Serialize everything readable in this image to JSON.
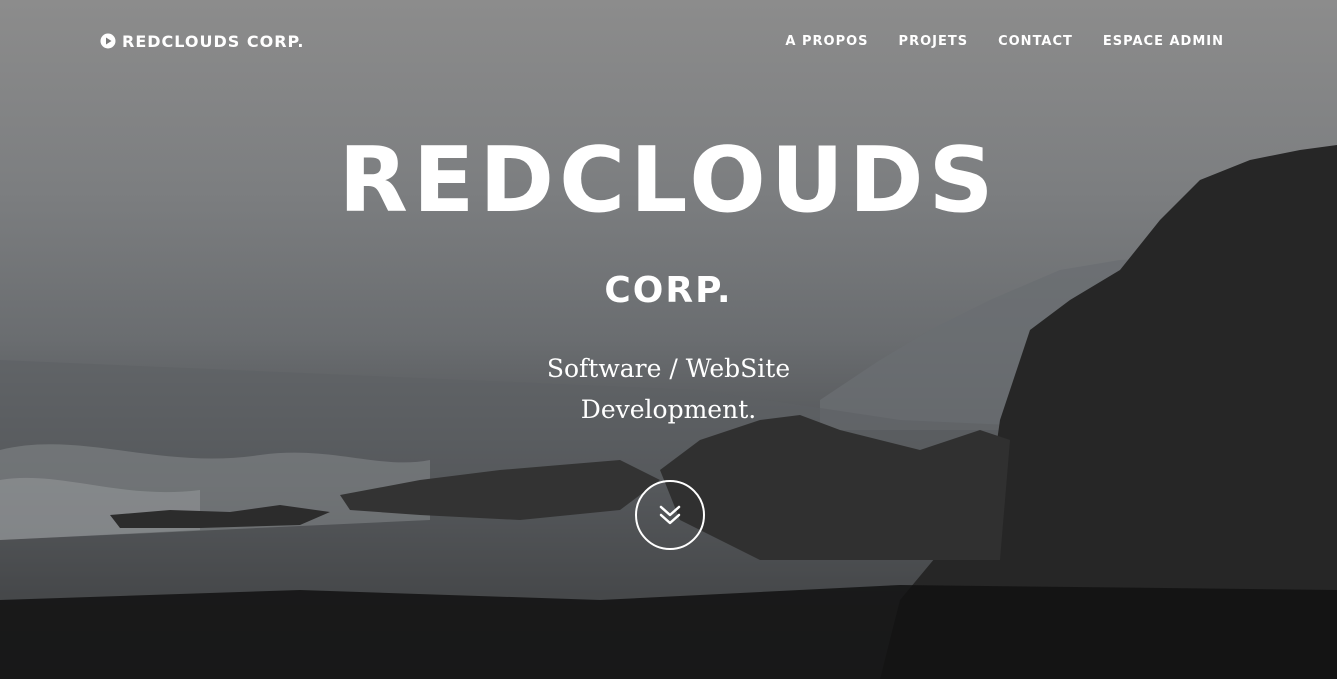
{
  "navbar": {
    "brand_label": "REDCLOUDS CORP.",
    "brand_icon": "play-circle-icon",
    "links": [
      {
        "label": "A PROPOS"
      },
      {
        "label": "PROJETS"
      },
      {
        "label": "CONTACT"
      },
      {
        "label": "ESPACE ADMIN"
      }
    ]
  },
  "hero": {
    "title": "REDCLOUDS",
    "subtitle": "CORP.",
    "tagline_line1": "Software / WebSite",
    "tagline_line2": "Development.",
    "scroll_icon": "double-chevron-down-icon"
  },
  "colors": {
    "text": "#ffffff",
    "background_top": "#8c8c8c",
    "background_bottom": "#0c0c0c"
  }
}
